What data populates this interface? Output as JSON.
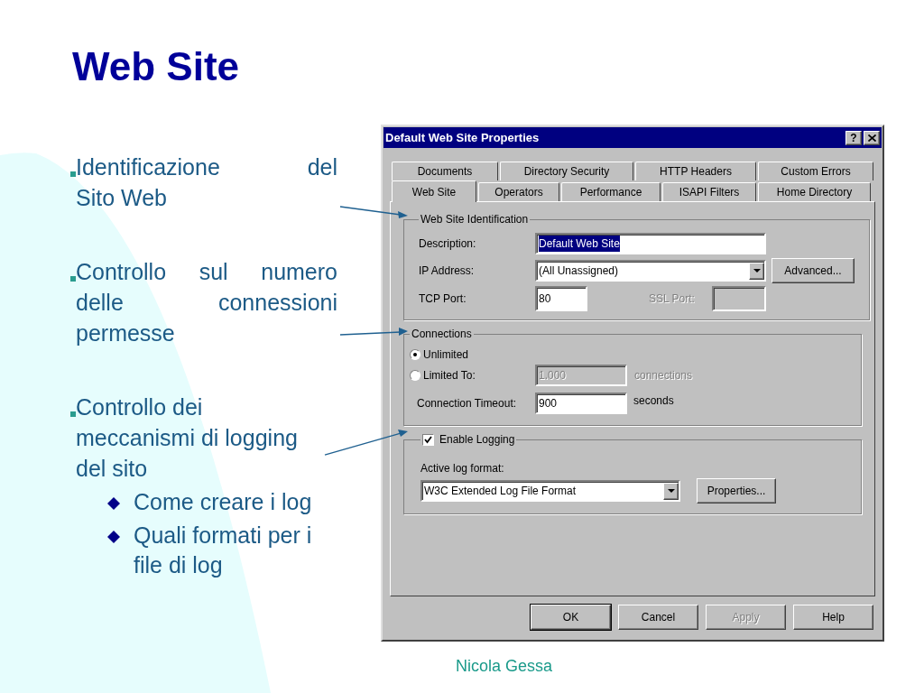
{
  "slide": {
    "title": "Web Site",
    "bullets": [
      {
        "lines": [
          "Identificazione del",
          "Sito Web"
        ],
        "justified": true
      },
      {
        "lines": [
          "Controllo sul numero",
          "delle connessioni",
          "permesse"
        ],
        "justified": true
      },
      {
        "lines": [
          "Controllo dei",
          "meccanismi di logging",
          "del sito"
        ],
        "justified": false,
        "children": [
          {
            "text": "Come creare i log"
          },
          {
            "text": "Quali formati per i file di log"
          }
        ]
      }
    ],
    "footer": "Nicola Gessa"
  },
  "dialog": {
    "title": "Default Web Site Properties",
    "help_glyph": "?",
    "tab_rows": [
      [
        {
          "label": "Documents",
          "selected": false
        },
        {
          "label": "Directory Security",
          "selected": false
        },
        {
          "label": "HTTP Headers",
          "selected": false
        },
        {
          "label": "Custom Errors",
          "selected": false
        }
      ],
      [
        {
          "label": "Web Site",
          "selected": true
        },
        {
          "label": "Operators",
          "selected": false
        },
        {
          "label": "Performance",
          "selected": false
        },
        {
          "label": "ISAPI Filters",
          "selected": false
        },
        {
          "label": "Home Directory",
          "selected": false
        }
      ]
    ],
    "identification": {
      "title": "Web Site Identification",
      "description_label": "Description:",
      "description_value": "Default Web Site",
      "text_selected": true,
      "ip_label": "IP Address:",
      "ip_value": "(All Unassigned)",
      "advanced_button": "Advanced...",
      "tcp_label": "TCP Port:",
      "tcp_value": "80",
      "ssl_label": "SSL Port:",
      "ssl_disabled": true
    },
    "connections": {
      "title": "Connections",
      "options": [
        {
          "label": "Unlimited",
          "selected": true
        },
        {
          "label": "Limited To:",
          "selected": false
        }
      ],
      "limit_value": "1.000",
      "limit_unit": "connections",
      "limit_disabled": true,
      "timeout_label": "Connection Timeout:",
      "timeout_value": "900",
      "timeout_unit": "seconds"
    },
    "logging": {
      "label": "Enable Logging",
      "checked": true,
      "format_label": "Active log format:",
      "format_value": "W3C Extended Log File Format",
      "properties_button": "Properties..."
    },
    "buttons": [
      {
        "label": "OK",
        "default": true,
        "disabled": false
      },
      {
        "label": "Cancel",
        "default": false,
        "disabled": false
      },
      {
        "label": "Apply",
        "default": false,
        "disabled": true
      },
      {
        "label": "Help",
        "default": false,
        "disabled": false
      }
    ]
  }
}
